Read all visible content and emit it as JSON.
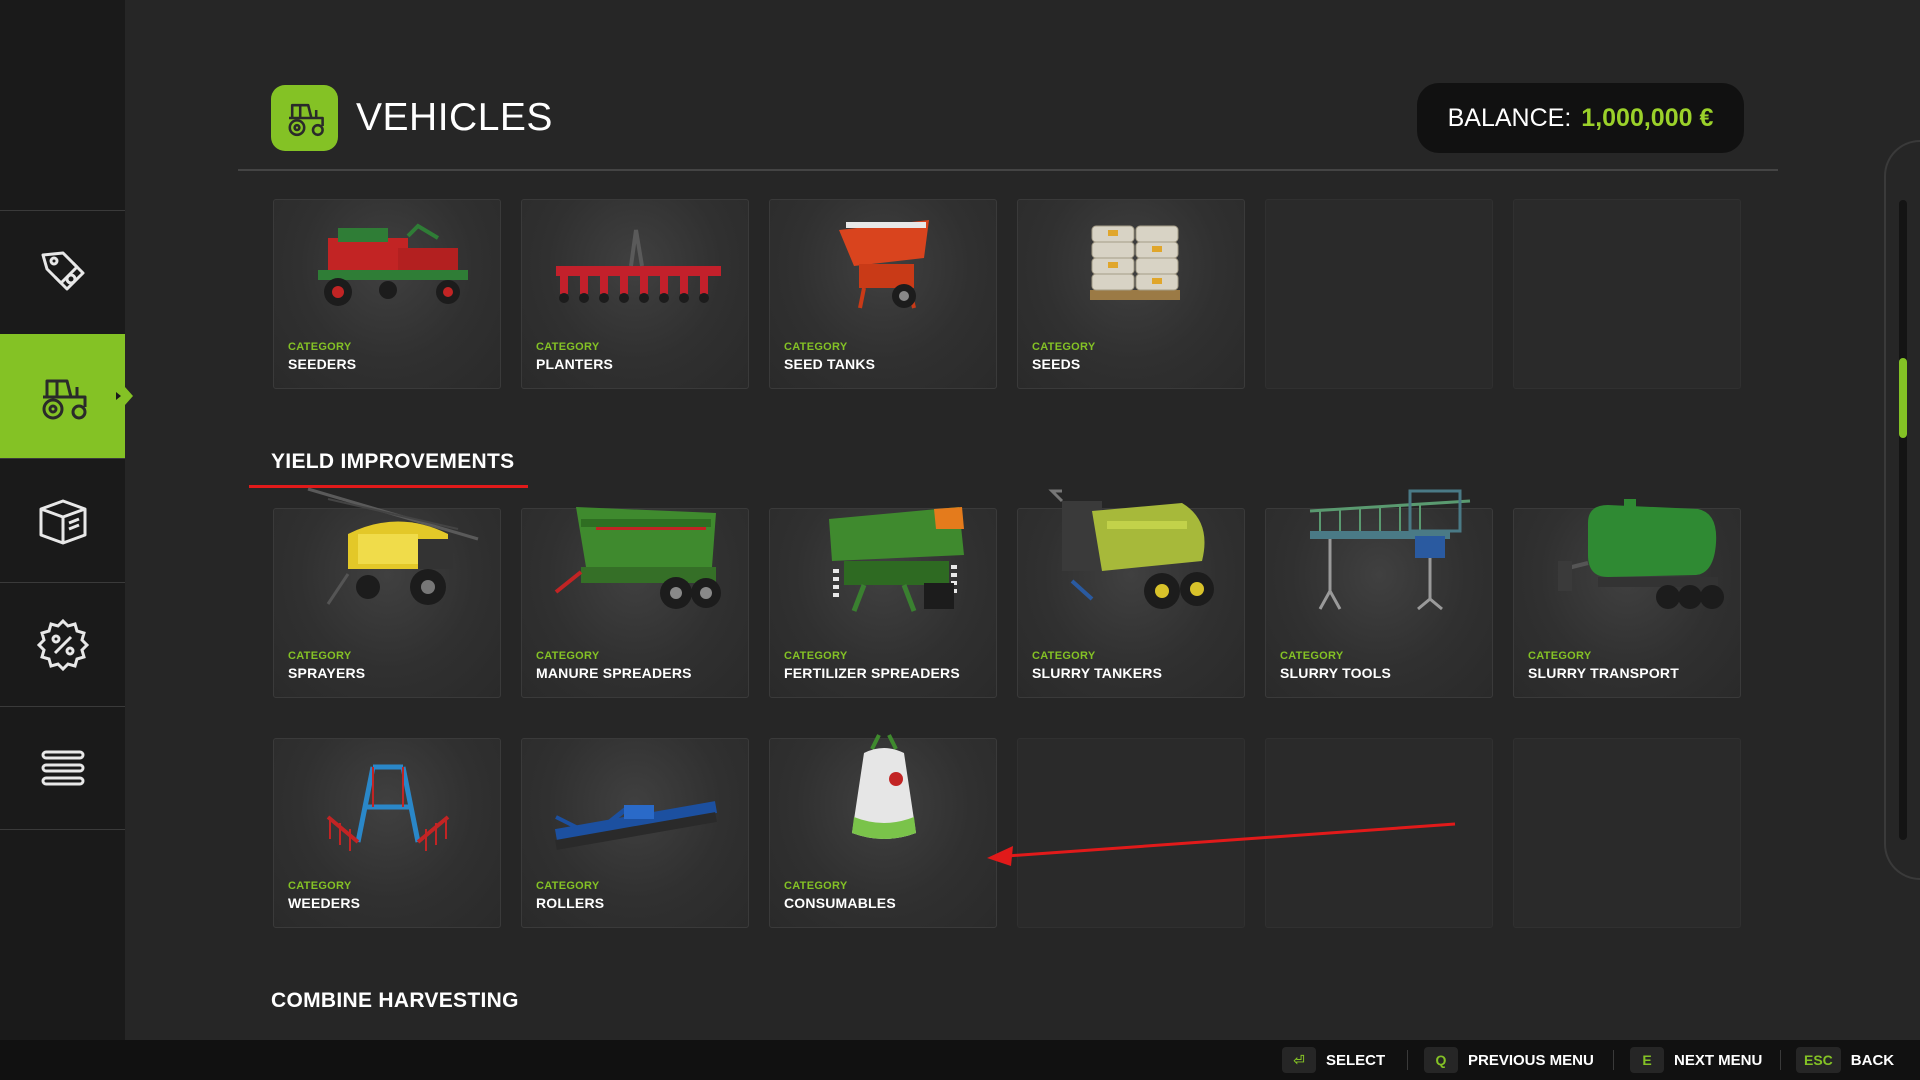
{
  "page": {
    "title": "VEHICLES",
    "balance_label": "BALANCE:",
    "balance_value": "1,000,000 €"
  },
  "sidebar": {
    "items": [
      {
        "name": "sales-icon"
      },
      {
        "name": "tractor-icon",
        "active": true
      },
      {
        "name": "box-icon"
      },
      {
        "name": "discount-icon"
      },
      {
        "name": "list-icon"
      }
    ]
  },
  "category_prefix": "CATEGORY",
  "sections": {
    "seeding": {
      "tiles": [
        {
          "name": "SEEDERS",
          "icon": "seeder-image"
        },
        {
          "name": "PLANTERS",
          "icon": "planter-image"
        },
        {
          "name": "SEED TANKS",
          "icon": "seed-tank-image"
        },
        {
          "name": "SEEDS",
          "icon": "seed-bags-image"
        }
      ]
    },
    "yield_improvements": {
      "title": "YIELD IMPROVEMENTS",
      "tiles": [
        {
          "name": "SPRAYERS",
          "icon": "sprayer-image"
        },
        {
          "name": "MANURE SPREADERS",
          "icon": "manure-spreader-image"
        },
        {
          "name": "FERTILIZER SPREADERS",
          "icon": "fertilizer-spreader-image"
        },
        {
          "name": "SLURRY TANKERS",
          "icon": "slurry-tanker-image"
        },
        {
          "name": "SLURRY TOOLS",
          "icon": "slurry-tool-image"
        },
        {
          "name": "SLURRY TRANSPORT",
          "icon": "slurry-transport-image"
        },
        {
          "name": "WEEDERS",
          "icon": "weeder-image"
        },
        {
          "name": "ROLLERS",
          "icon": "roller-image"
        },
        {
          "name": "CONSUMABLES",
          "icon": "bigbag-image"
        }
      ]
    },
    "combine_harvesting": {
      "title": "COMBINE HARVESTING"
    }
  },
  "footer": {
    "select_key": "⏎",
    "select_label": "SELECT",
    "prev_key": "Q",
    "prev_label": "PREVIOUS MENU",
    "next_key": "E",
    "next_label": "NEXT MENU",
    "back_key": "ESC",
    "back_label": "BACK"
  },
  "colors": {
    "accent": "#84c225",
    "balance": "#9bd12a",
    "annotation": "#e11a1a",
    "background": "#262626",
    "sidebar": "#1a1a1a"
  }
}
